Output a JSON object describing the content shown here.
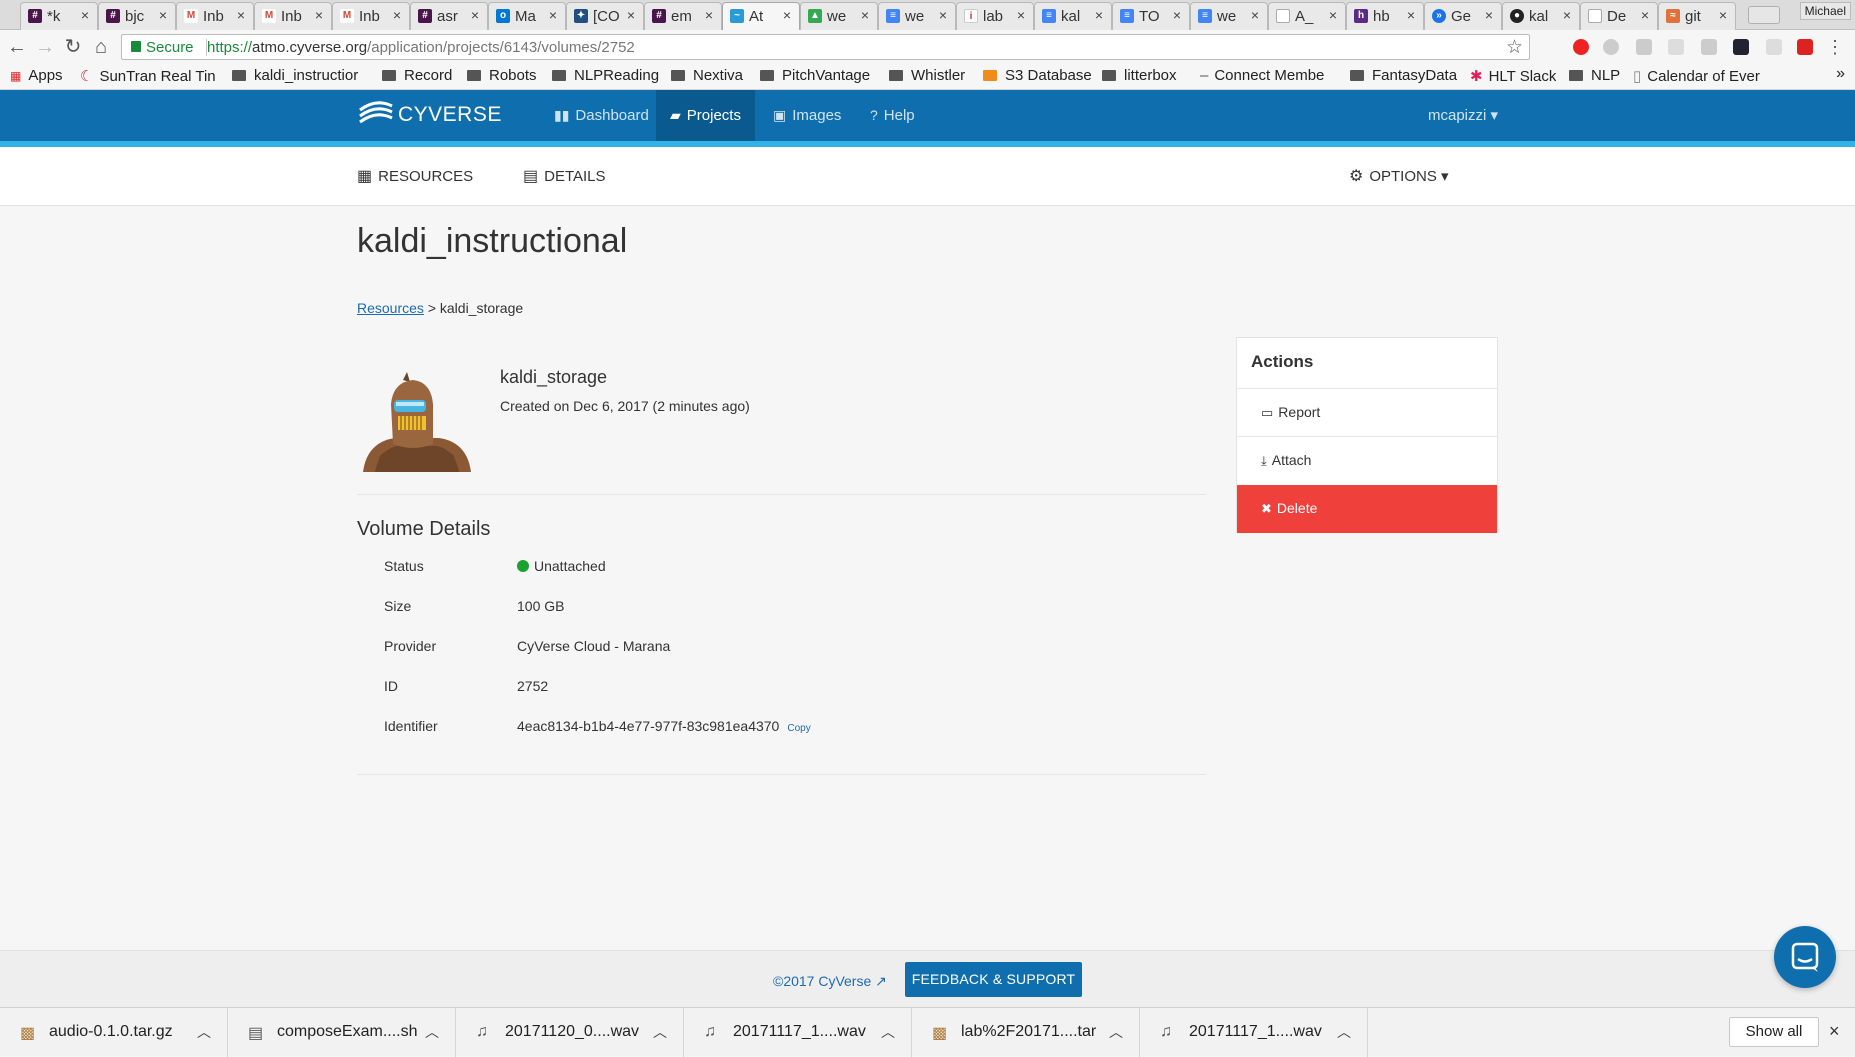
{
  "browser": {
    "tabs": [
      {
        "label": "*k",
        "favicon": "slack-icon",
        "color": "#4a154b"
      },
      {
        "label": "bjc",
        "favicon": "slack-icon",
        "color": "#4a154b"
      },
      {
        "label": "Inb",
        "favicon": "gmail-icon",
        "color": "#d44638"
      },
      {
        "label": "Inb",
        "favicon": "gmail-icon",
        "color": "#d44638"
      },
      {
        "label": "Inb",
        "favicon": "gmail-icon",
        "color": "#d44638"
      },
      {
        "label": "asr",
        "favicon": "slack-icon",
        "color": "#4a154b"
      },
      {
        "label": "Ma",
        "favicon": "outlook-icon",
        "color": "#0078d4"
      },
      {
        "label": "[CO",
        "favicon": "jira-icon",
        "color": "#205081"
      },
      {
        "label": "em",
        "favicon": "slack-icon",
        "color": "#4a154b"
      },
      {
        "label": "At",
        "favicon": "cyverse-icon",
        "color": "#2a9bd5"
      },
      {
        "label": "we",
        "favicon": "drive-icon",
        "color": "#34a853"
      },
      {
        "label": "we",
        "favicon": "docs-icon",
        "color": "#4285f4"
      },
      {
        "label": "lab",
        "favicon": "document-icon",
        "color": "#c0392b"
      },
      {
        "label": "kal",
        "favicon": "docs-icon",
        "color": "#4285f4"
      },
      {
        "label": "TO",
        "favicon": "docs-icon",
        "color": "#4285f4"
      },
      {
        "label": "we",
        "favicon": "docs-icon",
        "color": "#4285f4"
      },
      {
        "label": "A_",
        "favicon": "page-icon",
        "color": "#888888"
      },
      {
        "label": "hb",
        "favicon": "purple-app-icon",
        "color": "#5b2a86"
      },
      {
        "label": "Ge",
        "favicon": "chrome-app-icon",
        "color": "#1a73e8"
      },
      {
        "label": "kal",
        "favicon": "github-icon",
        "color": "#222222"
      },
      {
        "label": "De",
        "favicon": "page-icon",
        "color": "#888888"
      },
      {
        "label": "git",
        "favicon": "git-icon",
        "color": "#e0713a"
      }
    ],
    "profile_name": "Michael",
    "secure_label": "Secure",
    "url_scheme": "https://",
    "url_host": "atmo.cyverse.org",
    "url_path": "/application/projects/6143/volumes/2752",
    "bookmarks": [
      {
        "label": "Apps",
        "icon": "apps-grid-icon"
      },
      {
        "label": "SunTran Real Tin",
        "icon": "suntran-icon"
      },
      {
        "label": "kaldi_instructior",
        "icon": "folder-icon"
      },
      {
        "label": "Record",
        "icon": "folder-icon"
      },
      {
        "label": "Robots",
        "icon": "folder-icon"
      },
      {
        "label": "NLPReading",
        "icon": "folder-icon"
      },
      {
        "label": "Nextiva",
        "icon": "folder-icon"
      },
      {
        "label": "PitchVantage",
        "icon": "folder-icon"
      },
      {
        "label": "Whistler",
        "icon": "folder-icon"
      },
      {
        "label": "S3 Database",
        "icon": "aws-icon"
      },
      {
        "label": "litterbox",
        "icon": "folder-icon"
      },
      {
        "label": "Connect Membe",
        "icon": "dash-icon"
      },
      {
        "label": "FantasyData",
        "icon": "folder-icon"
      },
      {
        "label": "HLT Slack",
        "icon": "slack-icon"
      },
      {
        "label": "NLP",
        "icon": "folder-icon"
      },
      {
        "label": "Calendar of Ever",
        "icon": "page-icon"
      }
    ],
    "bookmarks_overflow": "»"
  },
  "app": {
    "logo_text": "CYVERSE",
    "nav": [
      {
        "label": "Dashboard",
        "icon": "dashboard-icon"
      },
      {
        "label": "Projects",
        "icon": "folder-open-icon",
        "active": true
      },
      {
        "label": "Images",
        "icon": "floppy-icon"
      },
      {
        "label": "Help",
        "icon": "help-icon"
      }
    ],
    "user": "mcapizzi",
    "subnav": {
      "resources": "RESOURCES",
      "details": "DETAILS",
      "options": "OPTIONS"
    },
    "project_title": "kaldi_instructional",
    "breadcrumb": {
      "link": "Resources",
      "separator": ">",
      "current": "kaldi_storage"
    },
    "volume": {
      "name": "kaldi_storage",
      "created": "Created on Dec 6, 2017 (2 minutes ago)"
    },
    "details": {
      "title": "Volume Details",
      "rows": [
        {
          "label": "Status",
          "value": "Unattached"
        },
        {
          "label": "Size",
          "value": "100 GB"
        },
        {
          "label": "Provider",
          "value": "CyVerse Cloud - Marana"
        },
        {
          "label": "ID",
          "value": "2752"
        },
        {
          "label": "Identifier",
          "value": "4eac8134-b1b4-4e77-977f-83c981ea4370"
        }
      ],
      "copy_label": "Copy"
    },
    "actions": {
      "title": "Actions",
      "report": "Report",
      "attach": "Attach",
      "delete": "Delete"
    },
    "footer": {
      "copyright": "©2017 CyVerse",
      "feedback": "FEEDBACK & SUPPORT"
    },
    "colors": {
      "nav": "#0f6fae",
      "accent": "#34b1e6",
      "delete": "#f0403c",
      "status_ok": "#1aa12e"
    }
  },
  "downloads": {
    "items": [
      {
        "name": "audio-0.1.0.tar.gz",
        "icon": "archive-icon"
      },
      {
        "name": "composeExam....sh",
        "icon": "file-icon"
      },
      {
        "name": "20171120_0....wav",
        "icon": "music-icon"
      },
      {
        "name": "20171117_1....wav",
        "icon": "music-icon"
      },
      {
        "name": "lab%2F20171....tar",
        "icon": "archive-icon"
      },
      {
        "name": "20171117_1....wav",
        "icon": "music-icon"
      }
    ],
    "show_all": "Show all",
    "close": "×"
  }
}
